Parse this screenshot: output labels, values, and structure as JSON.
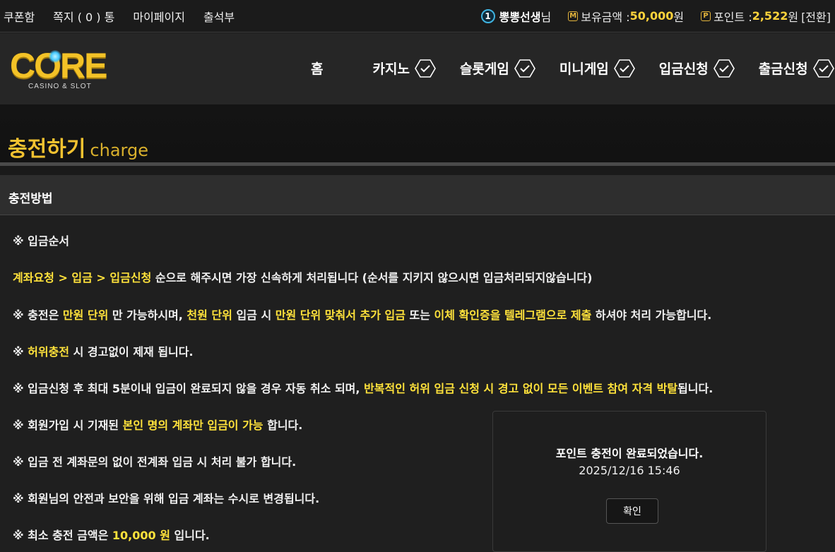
{
  "topbar": {
    "links": [
      "쿠폰함",
      "쪽지 ( 0 ) 통",
      "마이페이지",
      "출석부"
    ],
    "level": "1",
    "nickname": "뽕뽕선생",
    "nickname_suffix": "님",
    "balance_icon": "M",
    "balance_label": "보유금액 : ",
    "balance_value": "50,000",
    "balance_unit": "원",
    "point_icon": "P",
    "point_label": "포인트 : ",
    "point_value": "2,522",
    "point_unit": "원",
    "convert": "[전환]"
  },
  "logo": {
    "title": "CORE",
    "subtitle": "CASINO & SLOT"
  },
  "nav": [
    "홈",
    "카지노",
    "슬롯게임",
    "미니게임",
    "입금신청",
    "출금신청"
  ],
  "page": {
    "title_ko": "충전하기",
    "title_en": "charge"
  },
  "section": {
    "title": "충전방법"
  },
  "lines": [
    [
      {
        "t": "※ 입금순서",
        "h": false
      }
    ],
    [
      {
        "t": "계좌요청 > 입금 > 입금신청",
        "h": true
      },
      {
        "t": " 순으로 해주시면 가장 신속하게 처리됩니다 (순서를 지키지 않으시면 입금처리되지않습니다)",
        "h": false
      }
    ],
    [
      {
        "t": "※ 충전은 ",
        "h": false
      },
      {
        "t": "만원 단위",
        "h": true
      },
      {
        "t": " 만 가능하시며, ",
        "h": false
      },
      {
        "t": "천원 단위",
        "h": true
      },
      {
        "t": " 입금 시 ",
        "h": false
      },
      {
        "t": "만원 단위 맞춰서 추가 입금",
        "h": true
      },
      {
        "t": " 또는 ",
        "h": false
      },
      {
        "t": "이체 확인증을 텔레그램으로 제출",
        "h": true
      },
      {
        "t": " 하셔야 처리 가능합니다.",
        "h": false
      }
    ],
    [
      {
        "t": "※ ",
        "h": false
      },
      {
        "t": "허위충전",
        "h": true
      },
      {
        "t": " 시 경고없이 제재 됩니다.",
        "h": false
      }
    ],
    [
      {
        "t": "※ 입금신청 후 최대 5분이내 입금이 완료되지 않을 경우 자동 취소 되며, ",
        "h": false
      },
      {
        "t": "반복적인 허위 입금 신청 시 경고 없이 모든 이벤트 참여 자격 박탈",
        "h": true
      },
      {
        "t": "됩니다.",
        "h": false
      }
    ],
    [
      {
        "t": "※ 회원가입 시 기재된 ",
        "h": false
      },
      {
        "t": "본인 명의 계좌만 입금이 가능",
        "h": true
      },
      {
        "t": " 합니다.",
        "h": false
      }
    ],
    [
      {
        "t": "※ 입금 전 계좌문의 없이 전계좌 입금 시 처리 불가 합니다.",
        "h": false
      }
    ],
    [
      {
        "t": "※ 회원님의 안전과 보안을 위해 입금 계좌는 수시로 변경됩니다.",
        "h": false
      }
    ],
    [
      {
        "t": "※ 최소 충전 금액은 ",
        "h": false
      },
      {
        "t": "10,000 원",
        "h": true
      },
      {
        "t": " 입니다.",
        "h": false
      }
    ]
  ],
  "modal": {
    "message": "포인트 충전이 완료되었습니다.",
    "time": "2025/12/16 15:46",
    "confirm": "확인"
  },
  "colors": {
    "highlight": "#ffe23b",
    "accent_gold": "#f2c230",
    "level_ring": "#3fb3e0"
  }
}
